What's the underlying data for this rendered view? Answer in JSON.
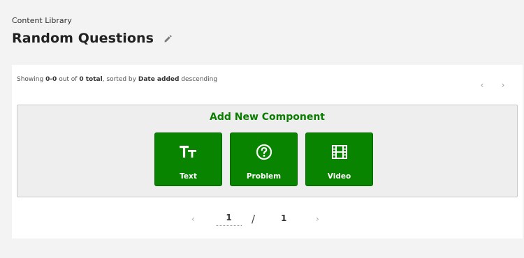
{
  "header": {
    "breadcrumb": "Content Library",
    "title": "Random Questions"
  },
  "listing": {
    "prefix": "Showing ",
    "range": "0-0",
    "middle": " out of ",
    "total": "0 total",
    "sorted_by_prefix": ", sorted by ",
    "sort_field": "Date added",
    "sort_order": " descending"
  },
  "top_nav": {
    "prev": "‹",
    "next": "›"
  },
  "add_component": {
    "title": "Add New Component",
    "buttons": [
      {
        "label": "Text",
        "icon": "text-format-icon"
      },
      {
        "label": "Problem",
        "icon": "question-circle-icon"
      },
      {
        "label": "Video",
        "icon": "film-icon"
      }
    ]
  },
  "pagination": {
    "prev": "‹",
    "current": "1",
    "separator": "/",
    "total": "1",
    "next": "›"
  },
  "colors": {
    "accent_green": "#088400",
    "title_green": "#0a7d00",
    "background": "#f3f3f3"
  }
}
